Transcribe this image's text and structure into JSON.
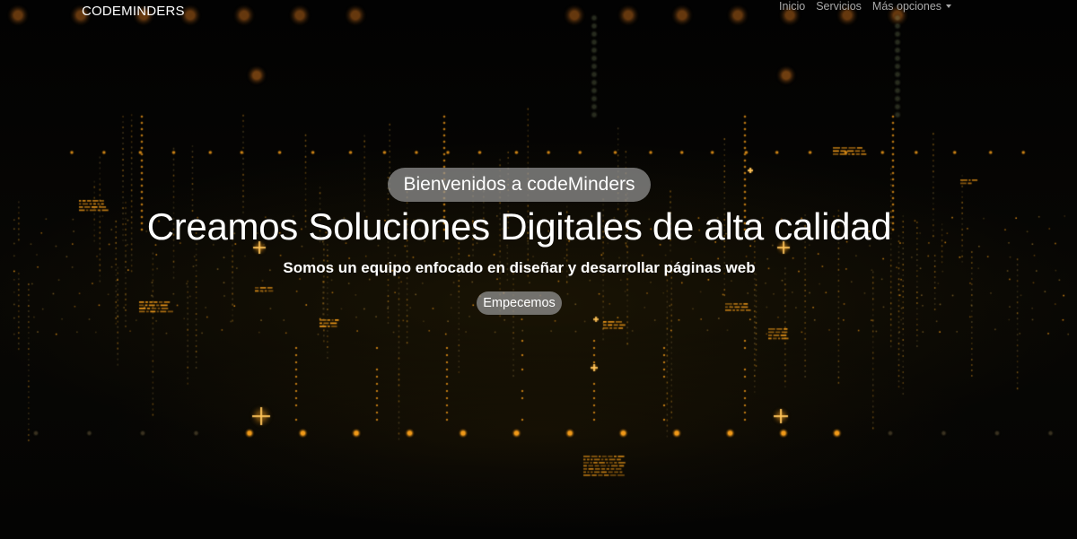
{
  "navbar": {
    "brand": "CODEMINDERS",
    "links": [
      {
        "label": "Inicio"
      },
      {
        "label": "Servicios"
      },
      {
        "label": "Más opciones",
        "dropdown": true
      }
    ]
  },
  "hero": {
    "badge": "Bienvenidos a codeMinders",
    "headline": "Creamos Soluciones Digitales de alta calidad",
    "subtitle": "Somos un equipo enfocado en diseñar y desarrollar páginas web",
    "cta_label": "Empecemos"
  },
  "background": {
    "image": "dark digital grid with glowing orange particles",
    "accent_color": "#ffa31a",
    "base_color": "#050503"
  },
  "icons": {
    "dropdown": "caret-down-icon"
  }
}
